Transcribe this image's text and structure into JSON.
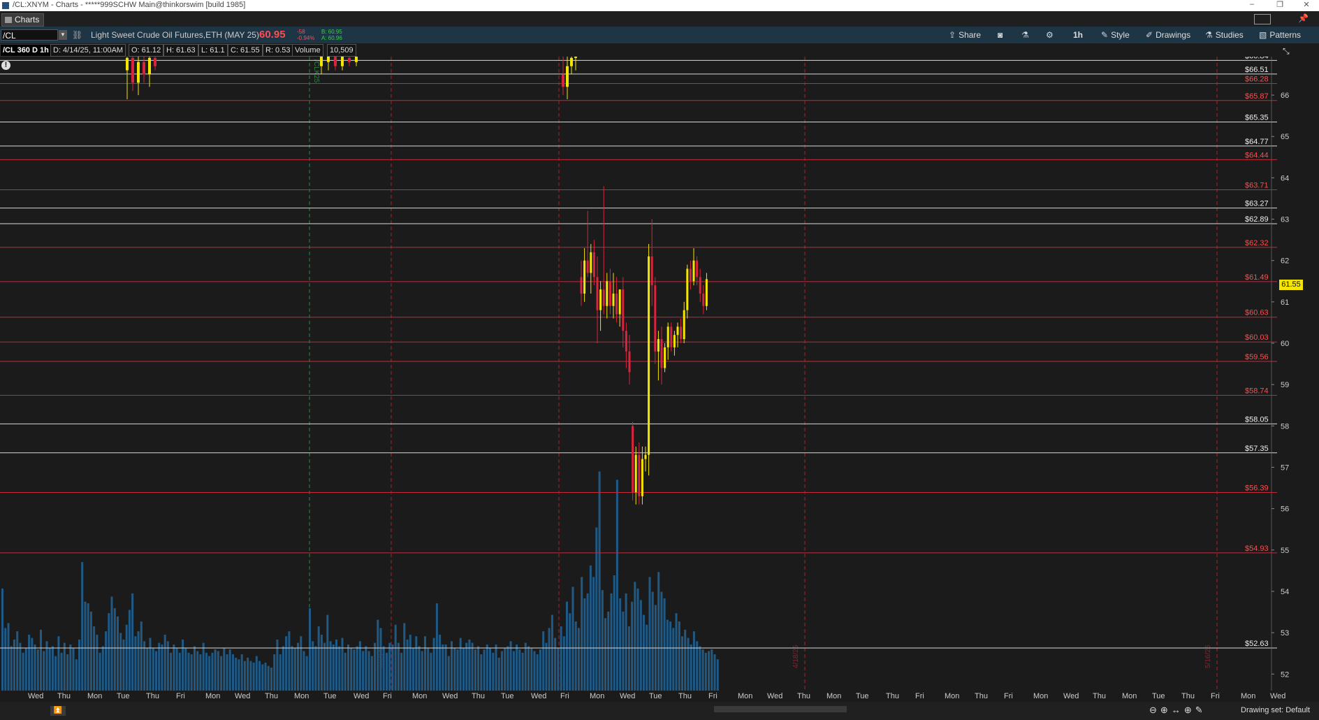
{
  "window": {
    "title": "/CL:XNYM - Charts - *****999SCHW Main@thinkorswim [build 1985]",
    "tab_label": "Charts",
    "controls": {
      "minimize": "–",
      "restore": "❐",
      "close": "✕"
    }
  },
  "toolbar": {
    "symbol": "/CL",
    "description": "Light Sweet Crude Oil Futures,ETH (MAY 25)",
    "last_price": "60.95",
    "net_change": "-58",
    "pct_change": "-0.94%",
    "bid": "B: 60.95",
    "ask": "A: 60.96",
    "timeframe": "1h",
    "buttons": {
      "share": "Share",
      "style": "Style",
      "drawings": "Drawings",
      "studies": "Studies",
      "patterns": "Patterns"
    },
    "colors": {
      "down": "#ff4d4d",
      "up": "#39d04a",
      "bar": "#1e3546"
    }
  },
  "infobar": {
    "chart_title": "/CL 360 D 1h",
    "date": "D: 4/14/25, 11:00AM",
    "open": "O: 61.12",
    "high": "H: 61.63",
    "low": "L: 61.1",
    "close": "C: 61.55",
    "range": "R: 0.53",
    "volume_label": "Volume",
    "volume_value": "10,509"
  },
  "chart_data": {
    "type": "bar",
    "symbol": "/CL",
    "ylim": [
      51.7,
      67.1
    ],
    "yticks": [
      52,
      53,
      54,
      55,
      56,
      57,
      58,
      59,
      60,
      61,
      62,
      63,
      64,
      65,
      66,
      67
    ],
    "last_price_label": "61.55",
    "price_levels": [
      {
        "price": 66.84,
        "label": "$66.84",
        "color": "white"
      },
      {
        "price": 66.51,
        "label": "$66.51",
        "color": "white"
      },
      {
        "price": 66.28,
        "label": "$66.28",
        "color": "red"
      },
      {
        "price": 65.87,
        "label": "$65.87",
        "color": "red"
      },
      {
        "price": 65.35,
        "label": "$65.35",
        "color": "white"
      },
      {
        "price": 64.77,
        "label": "$64.77",
        "color": "white"
      },
      {
        "price": 64.44,
        "label": "$64.44",
        "color": "red"
      },
      {
        "price": 63.71,
        "label": "$63.71",
        "color": "red"
      },
      {
        "price": 63.27,
        "label": "$63.27",
        "color": "white"
      },
      {
        "price": 62.89,
        "label": "$62.89",
        "color": "white"
      },
      {
        "price": 62.32,
        "label": "$62.32",
        "color": "red"
      },
      {
        "price": 61.49,
        "label": "$61.49",
        "color": "red"
      },
      {
        "price": 60.63,
        "label": "$60.63",
        "color": "red"
      },
      {
        "price": 60.03,
        "label": "$60.03",
        "color": "red"
      },
      {
        "price": 59.56,
        "label": "$59.56",
        "color": "red"
      },
      {
        "price": 58.74,
        "label": "$58.74",
        "color": "red"
      },
      {
        "price": 58.05,
        "label": "$58.05",
        "color": "white"
      },
      {
        "price": 57.35,
        "label": "$57.35",
        "color": "white"
      },
      {
        "price": 56.39,
        "label": "$56.39",
        "color": "red"
      },
      {
        "price": 54.93,
        "label": "$54.93",
        "color": "red"
      },
      {
        "price": 52.63,
        "label": "$52.63",
        "color": "white"
      }
    ],
    "candles_mar": [
      {
        "o": 66.6,
        "h": 67.0,
        "l": 65.9,
        "c": 66.9
      },
      {
        "o": 66.9,
        "h": 67.1,
        "l": 66.1,
        "c": 66.3
      },
      {
        "o": 66.3,
        "h": 67.0,
        "l": 66.0,
        "c": 66.8
      },
      {
        "o": 66.8,
        "h": 67.1,
        "l": 66.3,
        "c": 66.5
      },
      {
        "o": 66.5,
        "h": 67.0,
        "l": 66.2,
        "c": 66.9
      },
      {
        "o": 66.9,
        "h": 67.1,
        "l": 66.6,
        "c": 66.7
      },
      {
        "o": 66.7,
        "h": 67.1,
        "l": 66.5,
        "c": 67.0
      },
      {
        "o": 66.8,
        "h": 67.1,
        "l": 66.6,
        "c": 67.0
      },
      {
        "o": 67.0,
        "h": 67.1,
        "l": 66.6,
        "c": 66.7
      },
      {
        "o": 66.7,
        "h": 67.1,
        "l": 66.6,
        "c": 67.0
      },
      {
        "o": 66.9,
        "h": 67.1,
        "l": 66.7,
        "c": 66.8
      },
      {
        "o": 66.8,
        "h": 67.1,
        "l": 66.7,
        "c": 67.0
      }
    ],
    "candles_apr": [
      {
        "o": 66.5,
        "h": 67.0,
        "l": 66.0,
        "c": 66.2
      },
      {
        "o": 66.2,
        "h": 67.0,
        "l": 65.9,
        "c": 66.7
      },
      {
        "o": 66.7,
        "h": 67.1,
        "l": 66.5,
        "c": 66.9
      },
      {
        "o": 66.9,
        "h": 67.1,
        "l": 66.6,
        "c": 67.0
      }
    ],
    "candles_tariff": [
      {
        "o": 61.6,
        "h": 62.0,
        "l": 60.9,
        "c": 61.2
      },
      {
        "o": 61.2,
        "h": 62.3,
        "l": 61.0,
        "c": 62.0
      },
      {
        "o": 62.0,
        "h": 63.2,
        "l": 61.6,
        "c": 61.7
      },
      {
        "o": 61.7,
        "h": 62.4,
        "l": 61.2,
        "c": 62.2
      },
      {
        "o": 62.2,
        "h": 62.5,
        "l": 61.4,
        "c": 61.6
      },
      {
        "o": 61.6,
        "h": 62.1,
        "l": 60.0,
        "c": 60.8
      },
      {
        "o": 60.8,
        "h": 61.5,
        "l": 60.3,
        "c": 61.3
      },
      {
        "o": 61.3,
        "h": 63.8,
        "l": 60.7,
        "c": 60.9
      },
      {
        "o": 60.9,
        "h": 61.7,
        "l": 60.6,
        "c": 61.5
      },
      {
        "o": 61.5,
        "h": 61.8,
        "l": 60.7,
        "c": 60.9
      },
      {
        "o": 60.9,
        "h": 61.7,
        "l": 60.6,
        "c": 61.2
      },
      {
        "o": 61.2,
        "h": 61.6,
        "l": 60.5,
        "c": 60.7
      },
      {
        "o": 60.7,
        "h": 61.3,
        "l": 60.4,
        "c": 61.3
      },
      {
        "o": 61.3,
        "h": 61.6,
        "l": 59.9,
        "c": 60.3
      },
      {
        "o": 60.3,
        "h": 60.5,
        "l": 59.4,
        "c": 59.8
      },
      {
        "o": 59.8,
        "h": 60.2,
        "l": 59.0,
        "c": 59.3
      },
      {
        "o": 58.0,
        "h": 58.1,
        "l": 56.2,
        "c": 56.4
      },
      {
        "o": 56.4,
        "h": 57.5,
        "l": 56.1,
        "c": 57.3
      },
      {
        "o": 57.3,
        "h": 57.6,
        "l": 56.1,
        "c": 56.3
      },
      {
        "o": 56.3,
        "h": 57.5,
        "l": 56.1,
        "c": 57.2
      },
      {
        "o": 57.2,
        "h": 57.5,
        "l": 56.9,
        "c": 57.3
      },
      {
        "o": 57.3,
        "h": 62.4,
        "l": 56.8,
        "c": 62.1
      },
      {
        "o": 62.1,
        "h": 63.0,
        "l": 60.9,
        "c": 61.4
      },
      {
        "o": 61.4,
        "h": 61.6,
        "l": 59.5,
        "c": 59.8
      },
      {
        "o": 59.8,
        "h": 60.3,
        "l": 59.1,
        "c": 60.1
      },
      {
        "o": 60.1,
        "h": 60.4,
        "l": 59.0,
        "c": 59.4
      },
      {
        "o": 59.4,
        "h": 60.0,
        "l": 59.3,
        "c": 59.9
      },
      {
        "o": 59.9,
        "h": 60.5,
        "l": 59.6,
        "c": 60.4
      },
      {
        "o": 60.4,
        "h": 60.5,
        "l": 59.8,
        "c": 59.9
      },
      {
        "o": 59.9,
        "h": 60.3,
        "l": 59.7,
        "c": 60.2
      },
      {
        "o": 60.2,
        "h": 60.5,
        "l": 59.9,
        "c": 60.4
      },
      {
        "o": 60.4,
        "h": 60.6,
        "l": 60.0,
        "c": 60.1
      },
      {
        "o": 60.1,
        "h": 61.0,
        "l": 60.0,
        "c": 60.8
      },
      {
        "o": 60.8,
        "h": 61.9,
        "l": 60.6,
        "c": 61.8
      },
      {
        "o": 61.8,
        "h": 62.0,
        "l": 61.3,
        "c": 61.5
      },
      {
        "o": 61.5,
        "h": 62.3,
        "l": 61.4,
        "c": 62.0
      },
      {
        "o": 62.0,
        "h": 62.1,
        "l": 61.4,
        "c": 61.6
      },
      {
        "o": 61.6,
        "h": 61.8,
        "l": 61.0,
        "c": 61.2
      },
      {
        "o": 61.2,
        "h": 61.4,
        "l": 60.7,
        "c": 60.9
      },
      {
        "o": 60.9,
        "h": 61.7,
        "l": 60.8,
        "c": 61.55
      }
    ],
    "volume": [
      6200,
      3800,
      4100,
      2700,
      3100,
      3600,
      2900,
      2300,
      2600,
      3400,
      3200,
      2800,
      2500,
      3700,
      2400,
      3000,
      2600,
      2700,
      2100,
      3300,
      2300,
      2900,
      2200,
      2800,
      2600,
      1900,
      3100,
      7800,
      5400,
      5300,
      4800,
      3900,
      3400,
      2300,
      2700,
      3600,
      4700,
      5700,
      5000,
      4500,
      3500,
      3100,
      4000,
      4900,
      5900,
      3300,
      3600,
      4200,
      3000,
      2600,
      3200,
      2600,
      2400,
      2900,
      2800,
      3400,
      3000,
      2300,
      2800,
      2600,
      2300,
      3100,
      2600,
      2300,
      2200,
      2700,
      2400,
      2200,
      2900,
      2300,
      2100,
      2300,
      2500,
      2400,
      2100,
      2600,
      2200,
      2500,
      2200,
      2000,
      1900,
      2200,
      1800,
      2000,
      1800,
      1700,
      2100,
      1800,
      1600,
      1700,
      1500,
      1400,
      2200,
      3100,
      2200,
      2700,
      3300,
      3600,
      2700,
      2600,
      2900,
      3300,
      2400,
      2100,
      5000,
      3000,
      2700,
      3900,
      3400,
      2900,
      4600,
      3000,
      2800,
      3100,
      2700,
      3200,
      2300,
      2800,
      2600,
      2500,
      2700,
      3000,
      2400,
      2700,
      2400,
      2100,
      2900,
      4300,
      3800,
      2700,
      2300,
      2900,
      2800,
      4000,
      2900,
      2300,
      4100,
      3100,
      3400,
      2600,
      3300,
      2700,
      2400,
      3300,
      2600,
      2300,
      3200,
      5300,
      3400,
      2800,
      2800,
      2100,
      3000,
      2600,
      2500,
      3200,
      2600,
      2900,
      3100,
      2900,
      2500,
      2700,
      2200,
      2500,
      2800,
      2600,
      2300,
      2800,
      2000,
      2400,
      2600,
      2700,
      3000,
      2400,
      2800,
      2500,
      2300,
      2900,
      2700,
      2600,
      2400,
      2200,
      2500,
      3600,
      2900,
      3800,
      4600,
      3200,
      2600,
      3900,
      3300,
      5400,
      4700,
      6300,
      4200,
      3800,
      6900,
      5600,
      5900,
      7600,
      6900,
      9900,
      13300,
      6100,
      4400,
      4800,
      5900,
      7000,
      12800,
      5600,
      4800,
      5900,
      3900,
      5400,
      6600,
      6200,
      5500,
      4600,
      4000,
      6900,
      6000,
      5200,
      7200,
      6000,
      5600,
      4300,
      4200,
      3800,
      4700,
      4200,
      3300,
      3700,
      3200,
      2800,
      3600,
      3000,
      2700,
      2500,
      2300,
      2400,
      2500,
      2200,
      1900
    ],
    "x_tick_labels": [
      "Wed",
      "Thu",
      "Mon",
      "Tue",
      "Thu",
      "Fri",
      "Mon",
      "Wed",
      "Thu",
      "Mon",
      "Tue",
      "Wed",
      "Fri",
      "Mon",
      "Wed",
      "Thu",
      "Tue",
      "Wed",
      "Fri",
      "Mon",
      "Wed",
      "Tue",
      "Thu",
      "Fri",
      "Mon",
      "Wed",
      "Thu",
      "Mon",
      "Tue",
      "Thu",
      "Fri",
      "Mon",
      "Thu",
      "Fri",
      "Mon",
      "Wed",
      "Thu",
      "Mon",
      "Tue",
      "Thu",
      "Fri",
      "Mon",
      "Wed"
    ],
    "expiration_markers": [
      "/CLK25"
    ],
    "vline_labels": [
      "4/4/25",
      "4/18/25",
      "5/16/25"
    ],
    "colors": {
      "up": "#f4e600",
      "down": "#d8243c",
      "volume": "#1f5a86",
      "red_line": "#c8283a",
      "white_line": "#d8d8d8",
      "vgrid": "#3a3a3a"
    }
  },
  "statusbar": {
    "drawing_set": "Drawing set: Default",
    "zoom_tools": [
      "⊖",
      "⊕",
      "↔",
      "⊕",
      "✎"
    ]
  }
}
